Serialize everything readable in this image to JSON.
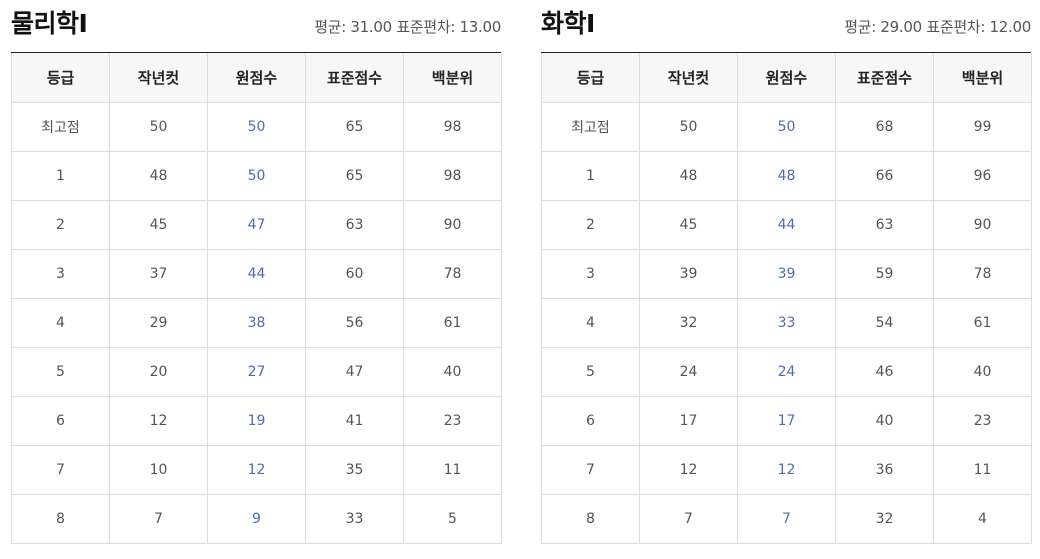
{
  "columns": [
    "등급",
    "작년컷",
    "원점수",
    "표준점수",
    "백분위"
  ],
  "subjects": [
    {
      "title": "물리학Ⅰ",
      "stats": "평균: 31.00 표준편차: 13.00",
      "rows": [
        [
          "최고점",
          "50",
          "50",
          "65",
          "98"
        ],
        [
          "1",
          "48",
          "50",
          "65",
          "98"
        ],
        [
          "2",
          "45",
          "47",
          "63",
          "90"
        ],
        [
          "3",
          "37",
          "44",
          "60",
          "78"
        ],
        [
          "4",
          "29",
          "38",
          "56",
          "61"
        ],
        [
          "5",
          "20",
          "27",
          "47",
          "40"
        ],
        [
          "6",
          "12",
          "19",
          "41",
          "23"
        ],
        [
          "7",
          "10",
          "12",
          "35",
          "11"
        ],
        [
          "8",
          "7",
          "9",
          "33",
          "5"
        ]
      ]
    },
    {
      "title": "화학Ⅰ",
      "stats": "평균: 29.00 표준편차: 12.00",
      "rows": [
        [
          "최고점",
          "50",
          "50",
          "68",
          "99"
        ],
        [
          "1",
          "48",
          "48",
          "66",
          "96"
        ],
        [
          "2",
          "45",
          "44",
          "63",
          "90"
        ],
        [
          "3",
          "39",
          "39",
          "59",
          "78"
        ],
        [
          "4",
          "32",
          "33",
          "54",
          "61"
        ],
        [
          "5",
          "24",
          "24",
          "46",
          "40"
        ],
        [
          "6",
          "17",
          "17",
          "40",
          "23"
        ],
        [
          "7",
          "12",
          "12",
          "36",
          "11"
        ],
        [
          "8",
          "7",
          "7",
          "32",
          "4"
        ]
      ]
    }
  ],
  "colors": {
    "raw_score_text": "#4a6fb5",
    "header_bg": "#f7f7f7",
    "grid_line": "#dddddd",
    "header_rule": "#222222"
  }
}
